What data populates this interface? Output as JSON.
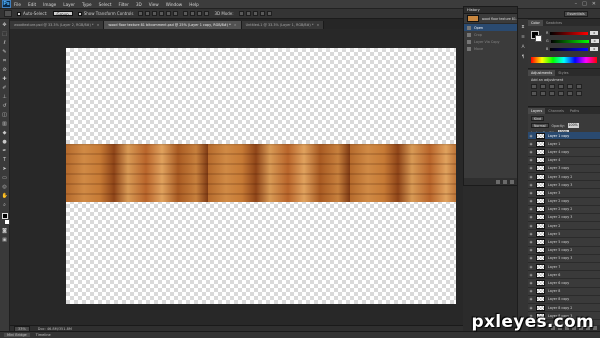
{
  "app": {
    "logo_text": "Ps",
    "menu": [
      "File",
      "Edit",
      "Image",
      "Layer",
      "Type",
      "Select",
      "Filter",
      "3D",
      "View",
      "Window",
      "Help"
    ],
    "window_controls": [
      "–",
      "□",
      "✕"
    ]
  },
  "options_bar": {
    "auto_select_label": "Auto-Select:",
    "auto_select_value": "Group",
    "show_transform_label": "Show Transform Controls",
    "mode_label": "3D Mode:",
    "workspace": "Essentials"
  },
  "tabs": [
    {
      "label": "woodtexture.psd @ 33.3% (Layer 2, RGB/8#) *",
      "active": false
    },
    {
      "label": "wood floor texture 81 bitcomment.psd @ 25% (Layer 1 copy, RGB/8#) *",
      "active": true
    },
    {
      "label": "Untitled-1 @ 33.3% (Layer 1, RGB/8#) *",
      "active": false
    }
  ],
  "status": {
    "zoom": "33%",
    "doc": "Doc: 46.8M/351.8M"
  },
  "bottom_tabs": [
    {
      "label": "Mini Bridge",
      "active": true
    },
    {
      "label": "Timeline",
      "active": false
    }
  ],
  "history": {
    "title": "History",
    "snapshot_label": "wood floor texture 81...",
    "items": [
      {
        "label": "Open",
        "active": true
      },
      {
        "label": "Crop",
        "active": false
      },
      {
        "label": "Layer Via Copy",
        "active": false
      },
      {
        "label": "Move",
        "active": false
      }
    ]
  },
  "color_panel": {
    "tabs": [
      "Color",
      "Swatches"
    ],
    "sliders": [
      {
        "channel": "R",
        "value": "0",
        "color": "#ff4040"
      },
      {
        "channel": "G",
        "value": "0",
        "color": "#40ff40"
      },
      {
        "channel": "B",
        "value": "0",
        "color": "#4060ff"
      }
    ]
  },
  "adjustments": {
    "tabs": [
      "Adjustments",
      "Styles"
    ],
    "title": "Add an adjustment"
  },
  "layers": {
    "tabs": [
      "Layers",
      "Channels",
      "Paths"
    ],
    "kind": "Kind",
    "blend_mode": "Normal",
    "opacity_label": "Opacity:",
    "opacity": "100%",
    "lock_label": "Lock:",
    "fill_label": "Fill:",
    "fill": "100%",
    "items": [
      {
        "name": "Layer 1 copy",
        "active": true
      },
      {
        "name": "Layer 1",
        "active": false
      },
      {
        "name": "Layer 4 copy",
        "active": false
      },
      {
        "name": "Layer 4",
        "active": false
      },
      {
        "name": "Layer 3 copy",
        "active": false
      },
      {
        "name": "Layer 3 copy 2",
        "active": false
      },
      {
        "name": "Layer 3 copy 3",
        "active": false
      },
      {
        "name": "Layer 3",
        "active": false
      },
      {
        "name": "Layer 2 copy",
        "active": false
      },
      {
        "name": "Layer 2 copy 2",
        "active": false
      },
      {
        "name": "Layer 2 copy 3",
        "active": false
      },
      {
        "name": "Layer 2",
        "active": false
      },
      {
        "name": "Layer 5",
        "active": false
      },
      {
        "name": "Layer 5 copy",
        "active": false
      },
      {
        "name": "Layer 5 copy 2",
        "active": false
      },
      {
        "name": "Layer 5 copy 3",
        "active": false
      },
      {
        "name": "Layer 7",
        "active": false
      },
      {
        "name": "Layer 6",
        "active": false
      },
      {
        "name": "Layer 6 copy",
        "active": false
      },
      {
        "name": "Layer 8",
        "active": false
      },
      {
        "name": "Layer 8 copy",
        "active": false
      },
      {
        "name": "Layer 8 copy 2",
        "active": false
      },
      {
        "name": "Layer 8 copy 3",
        "active": false
      }
    ]
  },
  "watermark": "pxleyes.com"
}
